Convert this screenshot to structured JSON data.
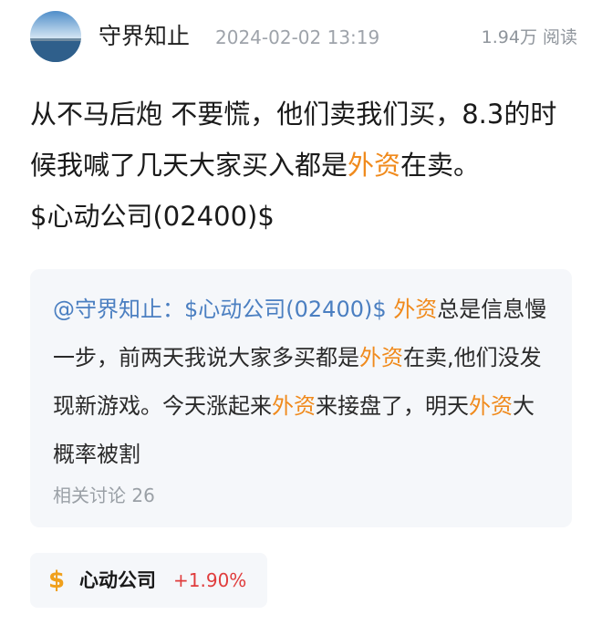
{
  "header": {
    "author": "守界知止",
    "timestamp": "2024-02-02 13:19",
    "views": "1.94万 阅读"
  },
  "post": {
    "seg1": "从不马后炮 不要慌，他们卖我们买，8.3的时候我喊了几天大家买入都是",
    "hl1": "外资",
    "seg2": "在卖。",
    "stock_tag": "$心动公司(02400)$"
  },
  "quote": {
    "mention": "@守界知止：$心动公司(02400)$",
    "hl1": "外资",
    "t1": "总是信息慢一步，前两天我说大家多买都是",
    "hl2": "外资",
    "t2": "在卖,他们没发现新游戏。今天涨起来",
    "hl3": "外资",
    "t3": "来接盘了，明天",
    "hl4": "外资",
    "t4": "大概率被割",
    "related": "相关讨论 26"
  },
  "stock_card": {
    "icon": "$",
    "name": "心动公司",
    "change": "+1.90%"
  },
  "colors": {
    "highlight": "#f08a1c",
    "mention": "#4b7fc1",
    "rise": "#e03c3c"
  }
}
